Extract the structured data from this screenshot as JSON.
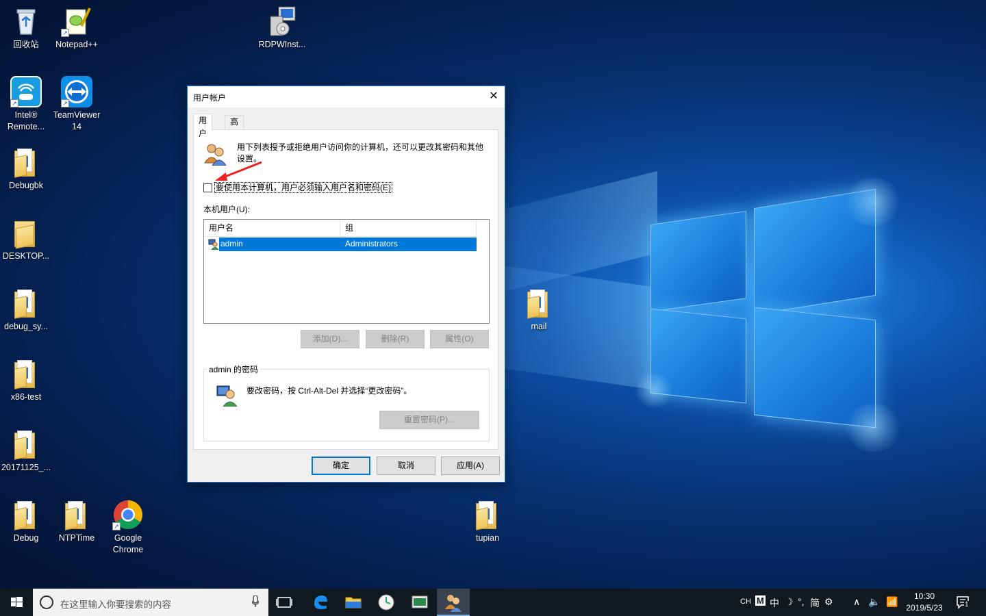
{
  "desktop": {
    "icons": {
      "recycle": "回收站",
      "notepad": "Notepad++",
      "rdpw": "RDPWInst...",
      "intel_l1": "Intel®",
      "intel_l2": "Remote...",
      "teamviewer_l1": "TeamViewer",
      "teamviewer_l2": "14",
      "debugbk": "Debugbk",
      "desktop": "DESKTOP...",
      "debug_sy": "debug_sy...",
      "x86": "x86-test",
      "d2017": "20171125_...",
      "debug": "Debug",
      "ntptime": "NTPTime",
      "chrome_l1": "Google",
      "chrome_l2": "Chrome",
      "mail": "mail",
      "tupian": "tupian"
    }
  },
  "dialog": {
    "title": "用户帐户",
    "close_glyph": "✕",
    "tabs": [
      "用户",
      "高级"
    ],
    "intro": "用下列表授予或拒绝用户访问你的计算机，还可以更改其密码和其他设置。",
    "checkbox_label": "要使用本计算机，用户必须输入用户名和密码(E)",
    "checkbox_checked": false,
    "users_label": "本机用户(U):",
    "columns": [
      "用户名",
      "组"
    ],
    "rows": [
      {
        "user": "admin",
        "group": "Administrators",
        "selected": true
      }
    ],
    "buttons": {
      "add": "添加(D)...",
      "remove": "删除(R)",
      "properties": "属性(O)"
    },
    "password_group_title": "admin 的密码",
    "password_text": "要改密码，按 Ctrl-Alt-Del 并选择“更改密码”。",
    "reset_button": "重置密码(P)...",
    "footer": {
      "ok": "确定",
      "cancel": "取消",
      "apply": "应用(A)"
    }
  },
  "taskbar": {
    "search_placeholder": "在这里输入你要搜索的内容",
    "tray": {
      "ch": "CH",
      "m": "M",
      "zhong": "中",
      "moon": "☽",
      "punct": "°,",
      "jian": "简",
      "gear": "⚙",
      "chevron": "∧",
      "speaker": "🔈",
      "wifi": "📶"
    },
    "time": "10:30",
    "date": "2019/5/23",
    "notification_count": "1"
  },
  "colors": {
    "accent": "#0078d7",
    "taskbar": "#101820",
    "annotation_arrow": "#e8231f"
  }
}
